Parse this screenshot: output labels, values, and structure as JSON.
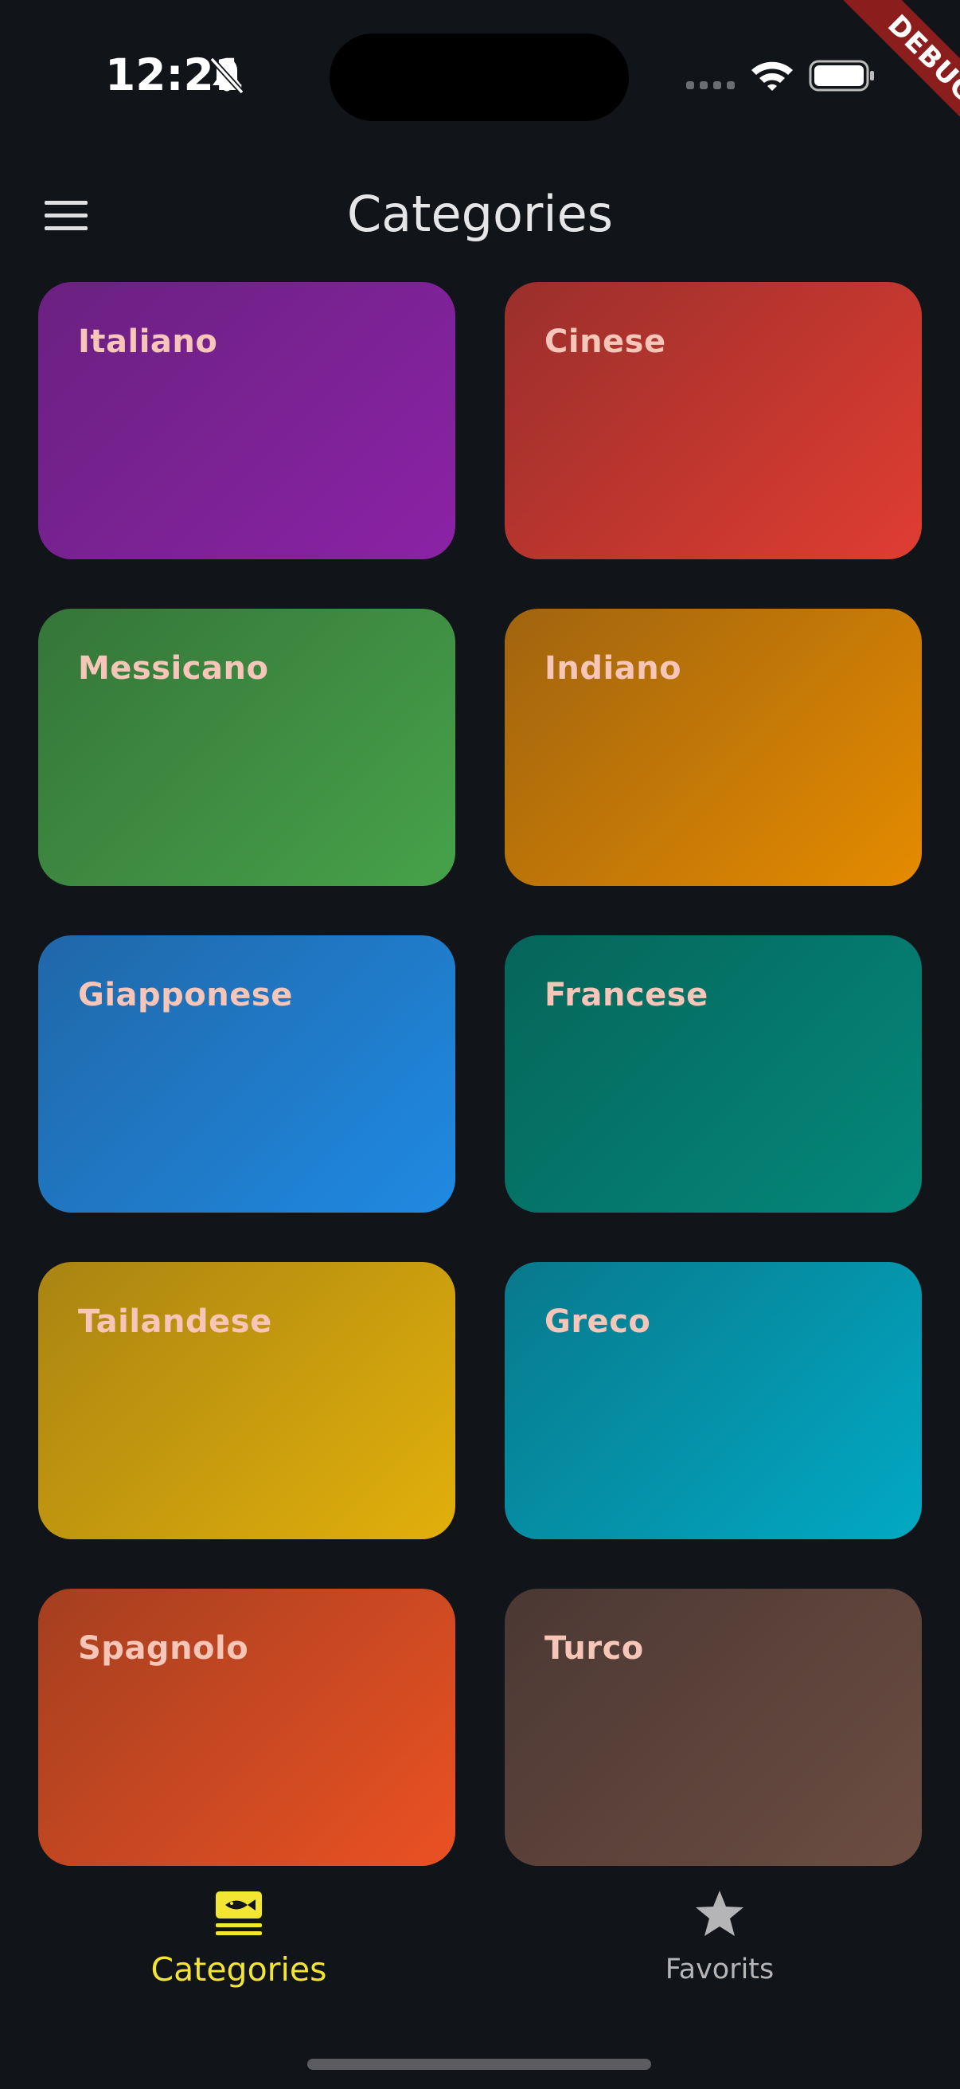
{
  "status_bar": {
    "time": "12:21",
    "icons": [
      "bell-slash-icon",
      "signal-icon",
      "wifi-icon",
      "battery-icon"
    ]
  },
  "debug_banner": "DEBUG",
  "app_bar": {
    "title": "Categories",
    "menu_icon": "hamburger-menu-icon"
  },
  "categories": [
    {
      "label": "Italiano",
      "color_from": "#6a2181",
      "color_to": "#8b22a6"
    },
    {
      "label": "Cinese",
      "color_from": "#9a2f2c",
      "color_to": "#e03d31"
    },
    {
      "label": "Messicano",
      "color_from": "#357539",
      "color_to": "#47a24a"
    },
    {
      "label": "Indiano",
      "color_from": "#a0640f",
      "color_to": "#e58b00"
    },
    {
      "label": "Giapponese",
      "color_from": "#2067a8",
      "color_to": "#1f8ae2"
    },
    {
      "label": "Francese",
      "color_from": "#06655a",
      "color_to": "#04887b"
    },
    {
      "label": "Tailandese",
      "color_from": "#a98412",
      "color_to": "#e2b00b"
    },
    {
      "label": "Greco",
      "color_from": "#08798c",
      "color_to": "#02a9c4"
    },
    {
      "label": "Spagnolo",
      "color_from": "#a43f20",
      "color_to": "#eb5123"
    },
    {
      "label": "Turco",
      "color_from": "#4b3833",
      "color_to": "#6c4d42"
    }
  ],
  "bottom_nav": {
    "items": [
      {
        "label": "Categories",
        "icon": "fish-plate-icon",
        "active": true
      },
      {
        "label": "Favorits",
        "icon": "star-icon",
        "active": false
      }
    ],
    "active_color": "#f2e632",
    "inactive_color": "#b5b5b8"
  }
}
